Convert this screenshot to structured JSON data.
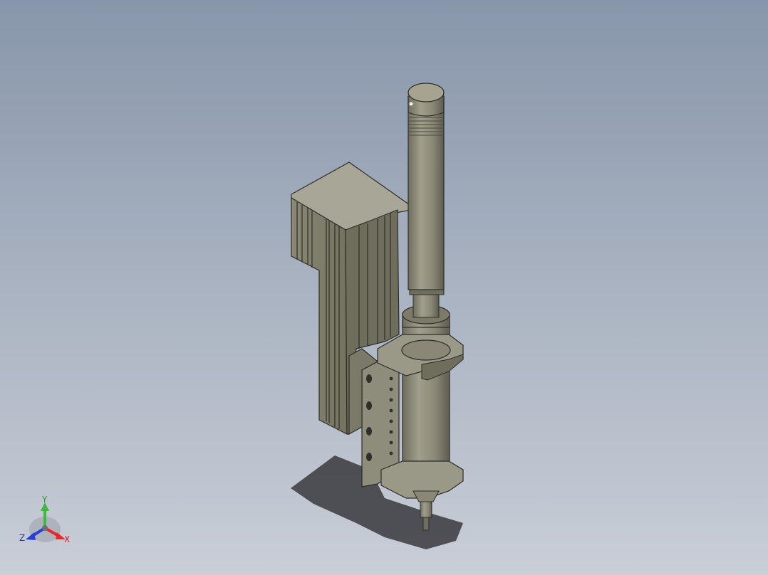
{
  "triad": {
    "x_label": "X",
    "y_label": "Y",
    "z_label": "Z",
    "x_color": "#e8262d",
    "y_color": "#3dba3d",
    "z_color": "#2a3fd8"
  },
  "model": {
    "body_color": "#8d8b79",
    "shadow_color": "#3a3a3e",
    "icon": "linear-actuator-dispenser-model"
  }
}
